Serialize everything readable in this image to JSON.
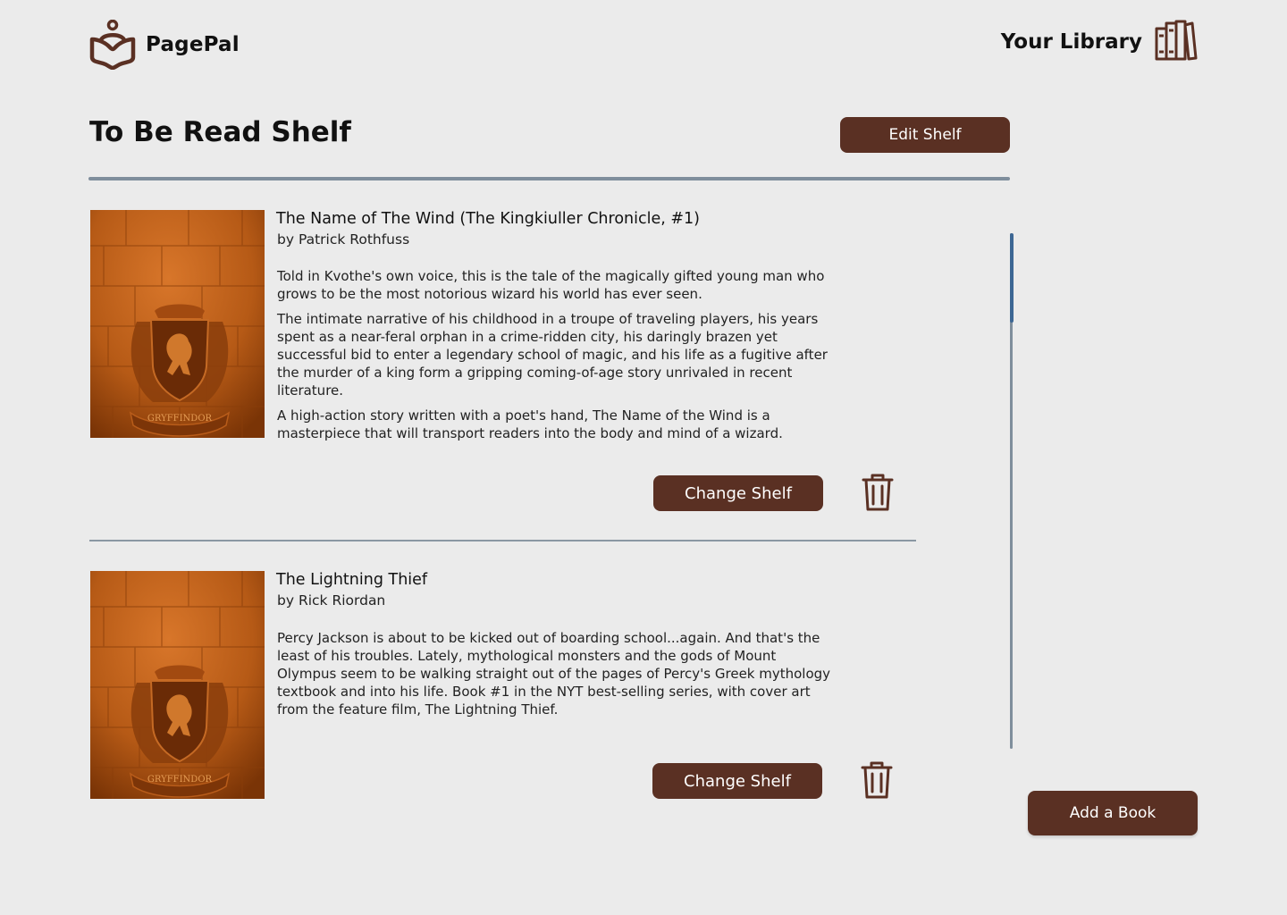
{
  "app": {
    "name": "PagePal"
  },
  "header": {
    "library_label": "Your Library",
    "library_icon": "bookshelf-icon",
    "logo_icon": "reader-book-logo-icon"
  },
  "shelf": {
    "title": "To Be Read Shelf",
    "edit_label": "Edit Shelf"
  },
  "books": [
    {
      "title": "The Name of The Wind (The Kingkiuller Chronicle, #1)",
      "author": "by Patrick Rothfuss",
      "paragraphs": [
        "Told in Kvothe's own voice, this is the tale of the magically gifted young man who grows to be the most notorious wizard his world has ever seen.",
        "The intimate narrative of his childhood in a troupe of traveling players, his years spent as a near-feral orphan in a crime-ridden city, his daringly brazen yet successful bid to enter a legendary school of magic, and his life as a fugitive after the murder of a king form a gripping coming-of-age story unrivaled in recent literature.",
        "A high-action story written with a poet's hand, The Name of the Wind is a masterpiece that will transport readers into the body and mind of a wizard."
      ],
      "cover_text": "GRYFFINDOR",
      "change_label": "Change Shelf",
      "delete_icon": "trash-icon"
    },
    {
      "title": "The Lightning Thief",
      "author": "by Rick Riordan",
      "paragraphs": [
        "Percy Jackson is about to be kicked out of boarding school...again. And that's the least of his troubles. Lately, mythological monsters and the gods of Mount Olympus seem to be walking straight out of the pages of Percy's Greek mythology textbook and into his life. Book #1 in the NYT best-selling series, with cover art from the feature film, The Lightning Thief."
      ],
      "cover_text": "GRYFFINDOR",
      "change_label": "Change Shelf",
      "delete_icon": "trash-icon"
    }
  ],
  "actions": {
    "add_book_label": "Add a Book"
  },
  "colors": {
    "background": "#EBEBEB",
    "primary": "#5A3023",
    "divider": "#7F8E9C",
    "scroll_thumb": "#3D6794"
  }
}
